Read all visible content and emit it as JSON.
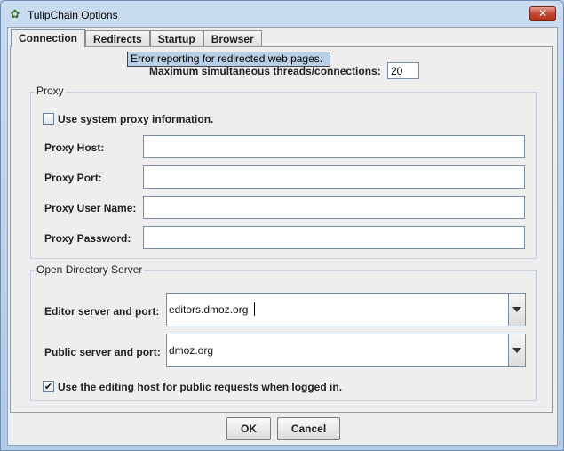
{
  "window": {
    "title": "TulipChain Options",
    "close_label": "✕"
  },
  "tabs": [
    {
      "label": "Connection",
      "active": true
    },
    {
      "label": "Redirects",
      "active": false
    },
    {
      "label": "Startup",
      "active": false
    },
    {
      "label": "Browser",
      "active": false
    }
  ],
  "tooltip": "Error reporting for redirected web pages.",
  "threads": {
    "label": "Maximum simultaneous threads/connections:",
    "value": "20"
  },
  "proxy": {
    "legend": "Proxy",
    "use_system_label": "Use system proxy information.",
    "use_system_checked": false,
    "host_label": "Proxy Host:",
    "host_value": "",
    "port_label": "Proxy Port:",
    "port_value": "",
    "user_label": "Proxy User Name:",
    "user_value": "",
    "password_label": "Proxy Password:",
    "password_value": ""
  },
  "ods": {
    "legend": "Open Directory Server",
    "editor_label": "Editor server and port:",
    "editor_value": "editors.dmoz.org",
    "public_label": "Public server and port:",
    "public_value": "dmoz.org",
    "editing_host_label": "Use the editing host for public requests when logged in.",
    "editing_host_checked": true,
    "check_mark": "✔"
  },
  "buttons": {
    "ok": "OK",
    "cancel": "Cancel"
  }
}
